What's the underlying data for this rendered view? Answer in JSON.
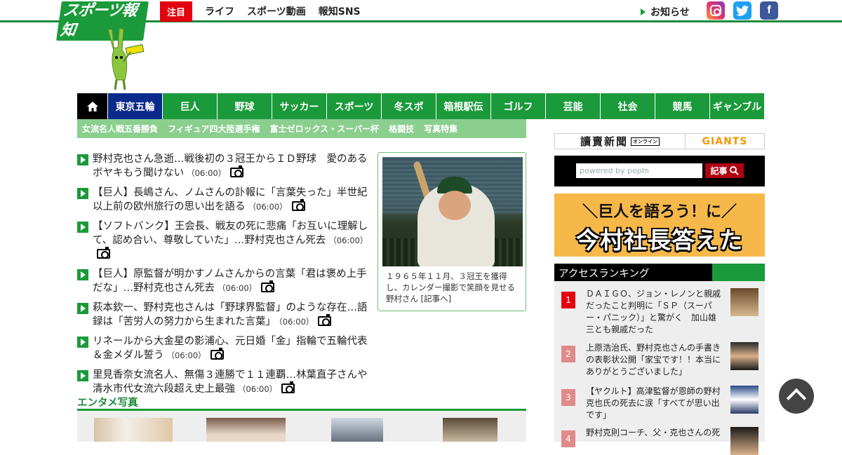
{
  "header": {
    "logo": "スポーツ報知",
    "hot_label": "注目",
    "nav": [
      "ライフ",
      "スポーツ動画",
      "報知SNS"
    ],
    "notice": "お知らせ",
    "social": {
      "instagram": "instagram-icon",
      "twitter": "t",
      "facebook": "f"
    }
  },
  "mainnav": {
    "items": [
      "東京五輪",
      "巨人",
      "野球",
      "サッカー",
      "スポーツ",
      "冬スポ",
      "箱根駅伝",
      "ゴルフ",
      "芸能",
      "社会",
      "競馬",
      "ギャンブル"
    ]
  },
  "subnav": [
    "女流名人戦五番勝負",
    "フィギュア四大陸選手権",
    "富士ゼロックス・スーパー杯",
    "格闘技",
    "写真特集"
  ],
  "news": [
    {
      "title": "野村克也さん急逝…戦後初の３冠王からＩＤ野球　愛のあるボヤキもう聞けない",
      "time": "（06:00）"
    },
    {
      "title": "【巨人】長嶋さん、ノムさんの訃報に「言葉失った」半世紀以上前の欧州旅行の思い出を語る",
      "time": "（06:00）"
    },
    {
      "title": "【ソフトバンク】王会長、戦友の死に悲痛「お互いに理解して、認め合い、尊敬していた」…野村克也さん死去",
      "time": "（06:00）"
    },
    {
      "title": "【巨人】原監督が明かすノムさんからの言葉「君は褒め上手だな」…野村克也さん死去",
      "time": "（06:00）"
    },
    {
      "title": "萩本欽一、野村克也さんは「野球界監督」のような存在…語録は「苦労人の努力から生まれた言葉」",
      "time": "（06:00）"
    },
    {
      "title": "リネールから大金星の影浦心、元日婚「金」指輪で五輪代表＆金メダル誓う",
      "time": "（06:00）"
    },
    {
      "title": "里見香奈女流名人、無傷３連勝で１１連覇…林葉直子さんや清水市代女流六段超え史上最強",
      "time": "（06:00）"
    }
  ],
  "photo": {
    "caption": "１９６５年１１月、３冠王を獲得し、カレンダー撮影で笑顔を見せる野村さん [記事へ]"
  },
  "entame": {
    "heading": "エンタメ写真"
  },
  "sidebar": {
    "yomiuri": "讀賣新聞",
    "yomiuri_tag": "オンライン",
    "giants": "GIANTS",
    "search_placeholder": "powered by popIn",
    "search_button": "記事",
    "banner_line1": "＼巨人を語ろう！に／",
    "banner_line2": "今村社長答えた",
    "ranking_title": "アクセスランキング",
    "ranking": [
      {
        "num": "1",
        "text": "ＤＡＩＧＯ、ジョン・レノンと親戚だったこと判明に「ＳＰ（スーパー・パニック）」と驚がく　加山雄三とも親戚だった"
      },
      {
        "num": "2",
        "text": "上原浩治氏、野村克也さんの手書きの表彰状公開「家宝です！！本当にありがとうございました」"
      },
      {
        "num": "3",
        "text": "【ヤクルト】高津監督が恩師の野村克也氏の死去に涙「すべてが思い出です」"
      },
      {
        "num": "4",
        "text": "野村克則コーチ、父・克也さんの死"
      }
    ]
  }
}
